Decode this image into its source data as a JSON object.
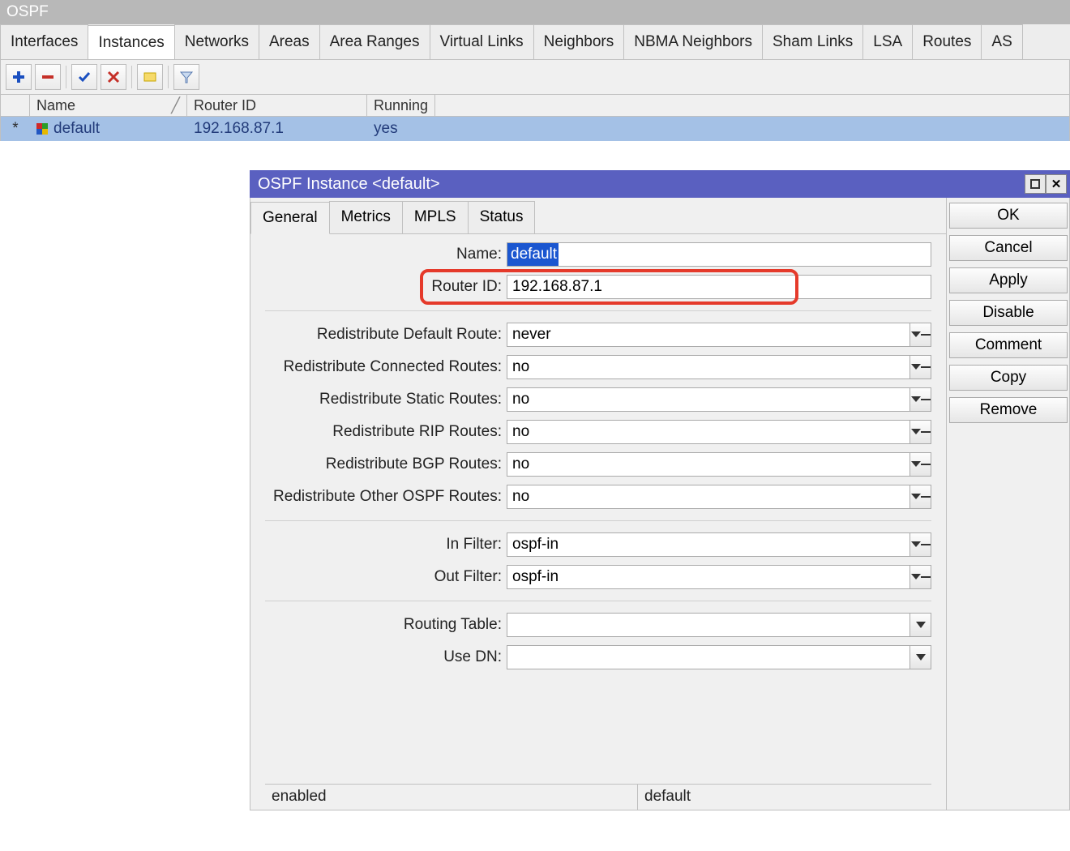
{
  "window": {
    "title": "OSPF"
  },
  "mainTabs": [
    "Interfaces",
    "Instances",
    "Networks",
    "Areas",
    "Area Ranges",
    "Virtual Links",
    "Neighbors",
    "NBMA Neighbors",
    "Sham Links",
    "LSA",
    "Routes",
    "AS"
  ],
  "mainActiveTab": "Instances",
  "grid": {
    "columns": {
      "name": "Name",
      "routerId": "Router ID",
      "running": "Running"
    },
    "rows": [
      {
        "star": "*",
        "name": "default",
        "routerId": "192.168.87.1",
        "running": "yes"
      }
    ]
  },
  "dialog": {
    "title": "OSPF Instance <default>",
    "tabs": [
      "General",
      "Metrics",
      "MPLS",
      "Status"
    ],
    "activeTab": "General",
    "form": {
      "name_label": "Name:",
      "name_value": "default",
      "routerid_label": "Router ID:",
      "routerid_value": "192.168.87.1",
      "redef_label": "Redistribute Default Route:",
      "redef_value": "never",
      "reconn_label": "Redistribute Connected Routes:",
      "reconn_value": "no",
      "restat_label": "Redistribute Static Routes:",
      "restat_value": "no",
      "rerip_label": "Redistribute RIP Routes:",
      "rerip_value": "no",
      "rebgp_label": "Redistribute BGP Routes:",
      "rebgp_value": "no",
      "reospf_label": "Redistribute Other OSPF Routes:",
      "reospf_value": "no",
      "infilter_label": "In Filter:",
      "infilter_value": "ospf-in",
      "outfilter_label": "Out Filter:",
      "outfilter_value": "ospf-in",
      "rtable_label": "Routing Table:",
      "rtable_value": "",
      "usedn_label": "Use DN:",
      "usedn_value": ""
    },
    "buttons": {
      "ok": "OK",
      "cancel": "Cancel",
      "apply": "Apply",
      "disable": "Disable",
      "comment": "Comment",
      "copy": "Copy",
      "remove": "Remove"
    },
    "status": {
      "left": "enabled",
      "right": "default"
    }
  }
}
